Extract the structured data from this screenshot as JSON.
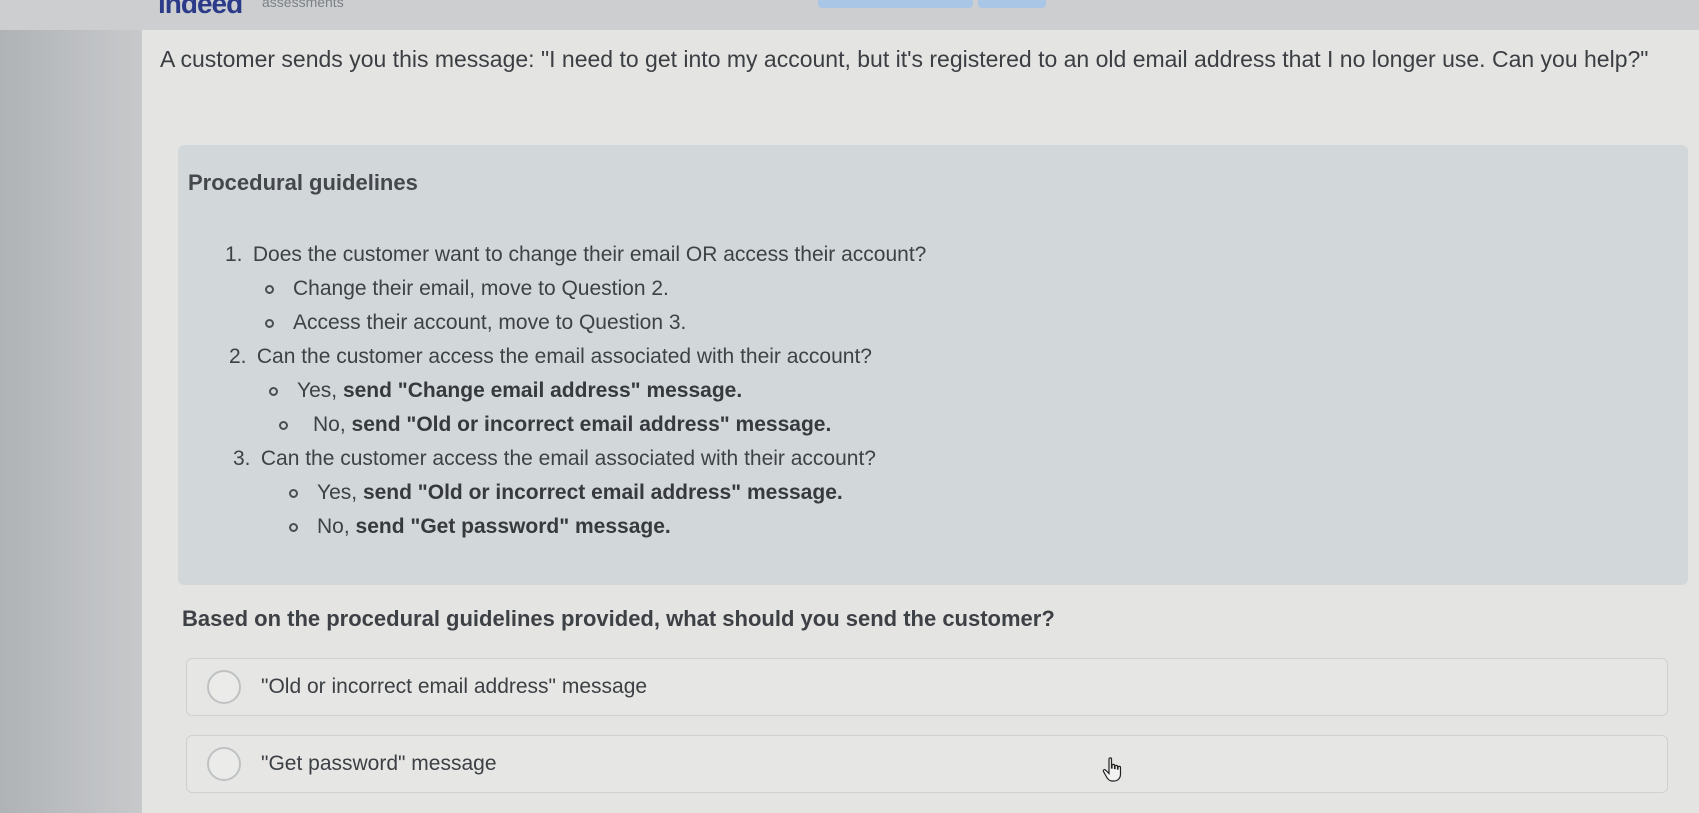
{
  "header": {
    "brand": "indeed",
    "brand_sub": "assessments"
  },
  "question_text": "A customer sends you this message: \"I need to get into my account, but it's registered to an old email address that I no longer use. Can you help?\"",
  "guidelines": {
    "title": "Procedural guidelines",
    "steps": [
      {
        "num": "1.",
        "text": "Does the customer want to change their email OR access their account?",
        "subs": [
          {
            "pre": "Change their email, move to Question 2.",
            "bold": ""
          },
          {
            "pre": "Access their account, move to Question 3.",
            "bold": ""
          }
        ]
      },
      {
        "num": "2.",
        "text": "Can the customer access the email associated with their account?",
        "subs": [
          {
            "pre": "Yes, ",
            "bold": "send \"Change email address\" message."
          },
          {
            "pre": "No, ",
            "bold": "send \"Old or incorrect email address\" message."
          }
        ]
      },
      {
        "num": "3.",
        "text": "Can the customer access the email associated with their account?",
        "subs": [
          {
            "pre": "Yes, ",
            "bold": "send \"Old or incorrect email address\" message."
          },
          {
            "pre": "No, ",
            "bold": "send \"Get password\" message."
          }
        ]
      }
    ]
  },
  "prompt": "Based on the procedural guidelines provided, what should you send the customer?",
  "options": [
    {
      "label": "\"Old or incorrect email address\" message"
    },
    {
      "label": "\"Get password\" message"
    }
  ],
  "icons": {
    "cursor": "hand-pointer-icon"
  }
}
